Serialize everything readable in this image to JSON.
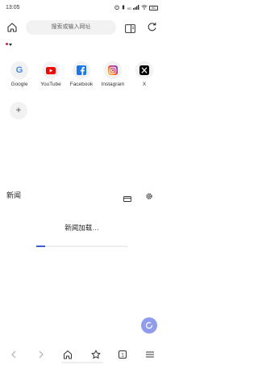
{
  "status_bar": {
    "time": "13:05",
    "icons": [
      "alarm-icon",
      "vibrate-icon",
      "signal-5g-icon",
      "wifi-icon"
    ],
    "signal_label": "5G",
    "battery_level": "80"
  },
  "toolbar": {
    "search_placeholder": "搜索或输入网址"
  },
  "shortcuts": [
    {
      "label": "Google",
      "icon": "google-icon"
    },
    {
      "label": "YouTube",
      "icon": "youtube-icon",
      "color": "#ff0000"
    },
    {
      "label": "Facebook",
      "icon": "facebook-icon",
      "color": "#1877f2"
    },
    {
      "label": "Instagram",
      "icon": "instagram-icon"
    },
    {
      "label": "X",
      "icon": "x-icon",
      "color": "#000000"
    }
  ],
  "add_shortcut_label": "+",
  "news": {
    "title": "新闻",
    "loading_text": "新闻加载…",
    "progress_fraction": 0.1
  },
  "bottom_nav": {
    "tab_count": "1",
    "items": [
      "back-icon",
      "forward-icon",
      "home-icon",
      "bookmark-icon",
      "tabs-icon",
      "menu-icon"
    ]
  },
  "colors": {
    "accent": "#3b5bdb",
    "fab": "#8f9cf0",
    "search_bg": "#f2f2f2"
  }
}
